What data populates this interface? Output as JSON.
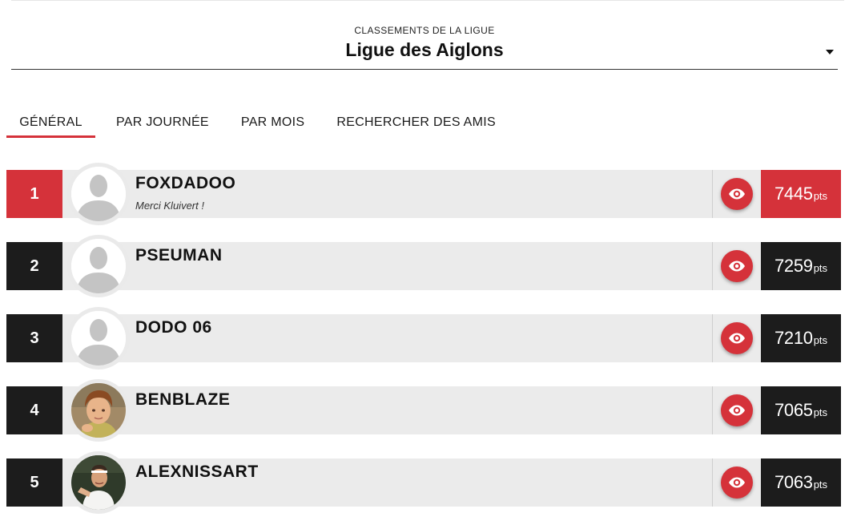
{
  "league": {
    "kicker": "CLASSEMENTS DE LA LIGUE",
    "name": "Ligue des Aiglons"
  },
  "tabs": [
    {
      "label": "GÉNÉRAL",
      "active": true
    },
    {
      "label": "PAR JOURNÉE",
      "active": false
    },
    {
      "label": "PAR MOIS",
      "active": false
    },
    {
      "label": "RECHERCHER DES AMIS",
      "active": false
    }
  ],
  "colors": {
    "accent": "#d5323a",
    "dark": "#1c1c1c",
    "row_background": "#ebebeb"
  },
  "icons": {
    "dropdown": "caret-down-icon",
    "view": "eye-icon",
    "default_avatar": "person-silhouette-icon"
  },
  "rankings": [
    {
      "rank": "1",
      "name": "FOXDADOO",
      "motto": "Merci Kluivert !",
      "score": "7445",
      "unit": "pts",
      "avatar": "default"
    },
    {
      "rank": "2",
      "name": "PSEUMAN",
      "motto": "",
      "score": "7259",
      "unit": "pts",
      "avatar": "default"
    },
    {
      "rank": "3",
      "name": "DODO 06",
      "motto": "",
      "score": "7210",
      "unit": "pts",
      "avatar": "default"
    },
    {
      "rank": "4",
      "name": "BENBLAZE",
      "motto": "",
      "score": "7065",
      "unit": "pts",
      "avatar": "photo-child"
    },
    {
      "rank": "5",
      "name": "ALEXNISSART",
      "motto": "",
      "score": "7063",
      "unit": "pts",
      "avatar": "photo-tennis"
    }
  ]
}
